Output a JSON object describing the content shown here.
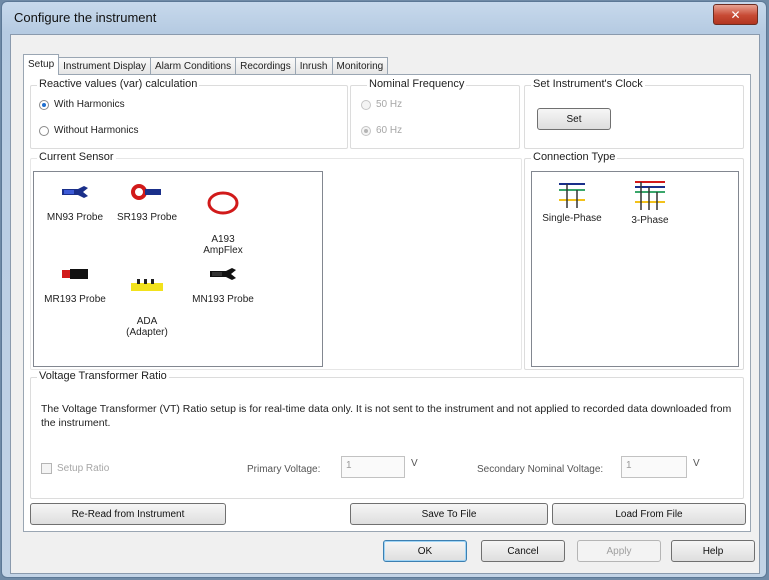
{
  "window": {
    "title": "Configure the instrument",
    "close_label": "✕"
  },
  "tabs": [
    {
      "label": "Setup"
    },
    {
      "label": "Instrument Display"
    },
    {
      "label": "Alarm Conditions"
    },
    {
      "label": "Recordings"
    },
    {
      "label": "Inrush"
    },
    {
      "label": "Monitoring"
    }
  ],
  "reactive": {
    "title": "Reactive values (var) calculation",
    "options": [
      {
        "label": "With Harmonics",
        "checked": true
      },
      {
        "label": "Without Harmonics",
        "checked": false
      }
    ]
  },
  "frequency": {
    "title": "Nominal Frequency",
    "options": [
      {
        "label": "50 Hz",
        "checked": false
      },
      {
        "label": "60 Hz",
        "checked": true
      }
    ]
  },
  "clock": {
    "title": "Set Instrument's Clock",
    "set_label": "Set"
  },
  "sensor": {
    "title": "Current Sensor",
    "items": [
      {
        "label": "MN93 Probe",
        "icon": "mn93-probe-icon"
      },
      {
        "label": "SR193 Probe",
        "icon": "sr193-probe-icon"
      },
      {
        "label": "A193\nAmpFlex",
        "icon": "ampflex-icon"
      },
      {
        "label": "MR193 Probe",
        "icon": "mr193-probe-icon"
      },
      {
        "label": "ADA\n(Adapter)",
        "icon": "adapter-icon"
      },
      {
        "label": "MN193 Probe",
        "icon": "mn193-probe-icon"
      }
    ]
  },
  "connection": {
    "title": "Connection Type",
    "items": [
      {
        "label": "Single-Phase",
        "icon": "single-phase-icon"
      },
      {
        "label": "3-Phase",
        "icon": "three-phase-icon"
      }
    ]
  },
  "vt": {
    "title": "Voltage Transformer Ratio",
    "description": "The Voltage Transformer (VT) Ratio setup is for real-time data only. It is not sent to the instrument and not applied to recorded data downloaded from the instrument.",
    "setup_ratio_label": "Setup Ratio",
    "primary_label": "Primary Voltage:",
    "primary_value": "1",
    "primary_unit": "V",
    "secondary_label": "Secondary Nominal Voltage:",
    "secondary_value": "1",
    "secondary_unit": "V"
  },
  "actions": {
    "reread": "Re-Read from Instrument",
    "save": "Save To File",
    "load": "Load From File"
  },
  "footer": {
    "ok": "OK",
    "cancel": "Cancel",
    "apply": "Apply",
    "help": "Help"
  },
  "colors": {
    "accent": "#1f6fd0",
    "probe_blue": "#1a2f8a",
    "probe_red": "#d11a1a",
    "adapter_yellow": "#f2e21c"
  }
}
